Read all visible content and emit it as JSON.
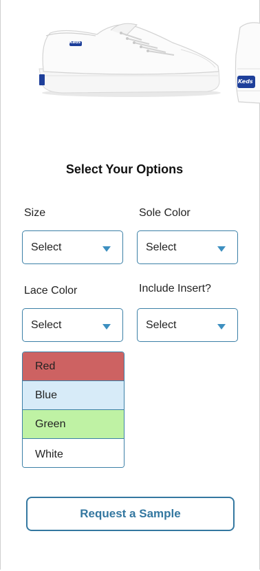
{
  "page": {
    "title": "Select Your Options"
  },
  "product": {
    "brand_label": "Keds"
  },
  "fields": {
    "size": {
      "label": "Size",
      "value": "Select"
    },
    "sole_color": {
      "label": "Sole Color",
      "value": "Select"
    },
    "lace_color": {
      "label": "Lace Color",
      "value": "Select"
    },
    "include_insert": {
      "label": "Include Insert?",
      "value": "Select"
    }
  },
  "lace_dropdown": {
    "options": [
      {
        "label": "Red",
        "color": "#cd6262"
      },
      {
        "label": "Blue",
        "color": "#d7ebf8"
      },
      {
        "label": "Green",
        "color": "#bff2a4"
      },
      {
        "label": "White",
        "color": "#ffffff"
      }
    ]
  },
  "cta": {
    "label": "Request a Sample"
  },
  "colors": {
    "accent": "#3377a0",
    "caret": "#3d8fc0"
  }
}
